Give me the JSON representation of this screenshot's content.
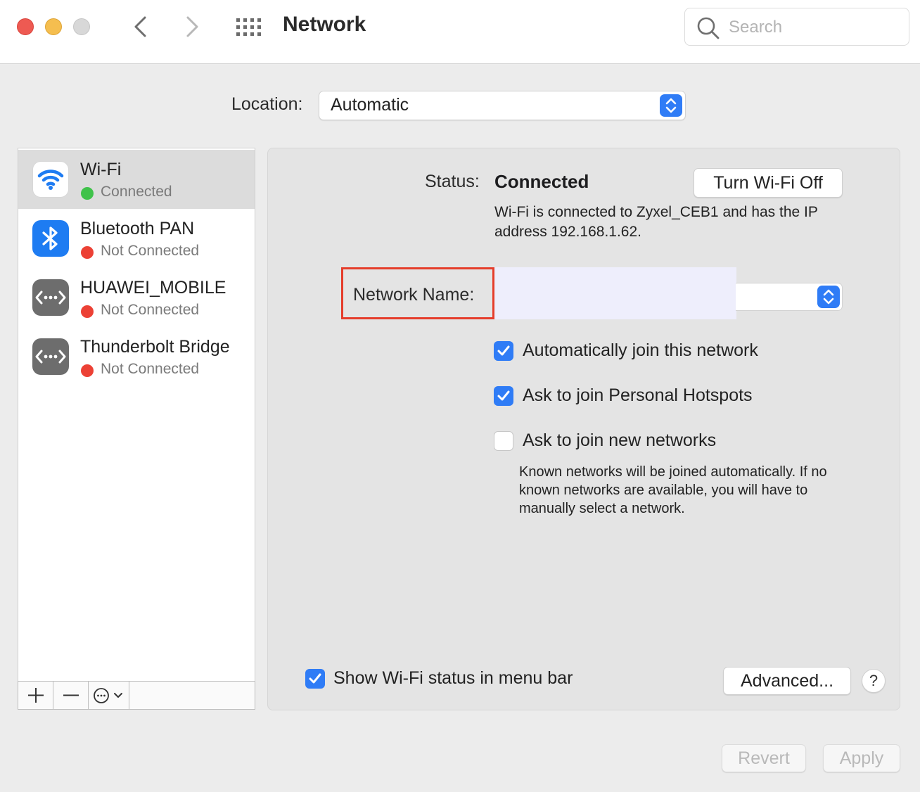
{
  "window": {
    "title": "Network",
    "search_placeholder": "Search",
    "icons": {
      "close": "close-icon",
      "minimize": "minimize-icon",
      "zoom": "zoom-icon",
      "back": "chevron-left-icon",
      "forward": "chevron-right-icon",
      "show_all": "grid-icon",
      "search": "search-icon"
    }
  },
  "location": {
    "label": "Location:",
    "value": "Automatic"
  },
  "services": [
    {
      "name": "Wi-Fi",
      "status": "Connected",
      "status_color": "#3fc24a",
      "icon": "wifi-icon",
      "selected": true
    },
    {
      "name": "Bluetooth PAN",
      "status": "Not Connected",
      "status_color": "#ec4135",
      "icon": "bluetooth-icon",
      "selected": false
    },
    {
      "name": "HUAWEI_MOBILE",
      "status": "Not Connected",
      "status_color": "#ec4135",
      "icon": "ethernet-icon",
      "selected": false
    },
    {
      "name": "Thunderbolt Bridge",
      "status": "Not Connected",
      "status_color": "#ec4135",
      "icon": "ethernet-icon",
      "selected": false
    }
  ],
  "sidebar_tools": {
    "add": "plus-icon",
    "remove": "minus-icon",
    "actions": "ellipsis-circle-icon"
  },
  "detail": {
    "status_label": "Status:",
    "status_value": "Connected",
    "turn_off_label": "Turn Wi-Fi Off",
    "status_description": "Wi-Fi is connected to Zyxel_CEB1 and has the IP address 192.168.1.62.",
    "network_name_label": "Network Name:",
    "network_name_value": "",
    "options": [
      {
        "label": "Automatically join this network",
        "checked": true
      },
      {
        "label": "Ask to join Personal Hotspots",
        "checked": true
      },
      {
        "label": "Ask to join new networks",
        "checked": false
      }
    ],
    "note": "Known networks will be joined automatically. If no known networks are available, you will have to manually select a network.",
    "show_status_label": "Show Wi-Fi status in menu bar",
    "show_status_checked": true,
    "advanced_label": "Advanced...",
    "help_label": "?"
  },
  "footer": {
    "revert_label": "Revert",
    "apply_label": "Apply"
  },
  "colors": {
    "accent": "#2f7cf6",
    "highlight_box": "#e53d2b",
    "connected": "#3fc24a",
    "not_connected": "#ec4135"
  }
}
